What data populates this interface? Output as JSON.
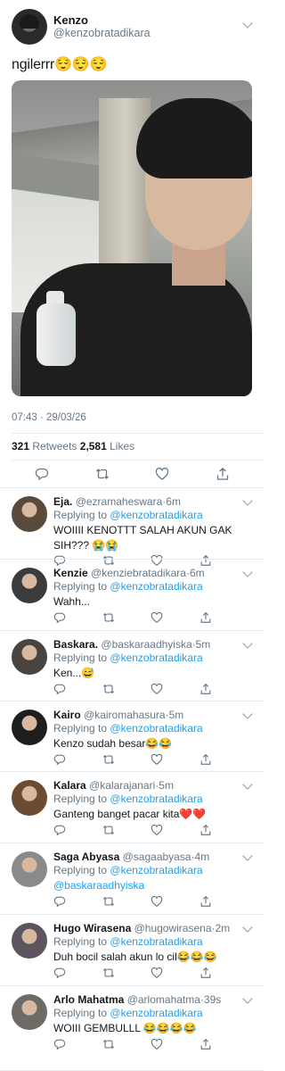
{
  "main_tweet": {
    "display_name": "Kenzo",
    "handle": "@kenzobratadikara",
    "text": "ngilerrr😌😌😌",
    "timestamp": "07:43 · 29/03/26",
    "retweets_count": "321",
    "retweets_label": "Retweets",
    "likes_count": "2,581",
    "likes_label": "Likes"
  },
  "action_icons": [
    "reply-icon",
    "retweet-icon",
    "like-icon",
    "share-icon"
  ],
  "replying_label": "Replying to",
  "replying_handle": "@kenzobratadikara",
  "replies": [
    {
      "name": "Eja.",
      "handle": "@ezramaheswara",
      "time": "6m",
      "text": "WOIIII KENOTTT SALAH AKUN GAK SIH??? 😭😭",
      "avatar_color": "#5a4a3c"
    },
    {
      "name": "Kenzie",
      "handle": "@kenziebratadikara",
      "time": "6m",
      "text": "Wahh...",
      "avatar_color": "#3b3b3b"
    },
    {
      "name": "Baskara.",
      "handle": "@baskaraadhyiska",
      "time": "5m",
      "text": "Ken...😅",
      "avatar_color": "#4a4440"
    },
    {
      "name": "Kairo",
      "handle": "@kairomahasura",
      "time": "5m",
      "text": "Kenzo sudah besar😂😂",
      "avatar_color": "#1e1e1e"
    },
    {
      "name": "Kalara",
      "handle": "@kalarajanari",
      "time": "5m",
      "text": "Ganteng banget pacar kita❤️❤️",
      "avatar_color": "#6b4c32"
    },
    {
      "name": "Saga Abyasa",
      "handle": "@sagaabyasa",
      "time": "4m",
      "text": "@baskaraadhyiska",
      "avatar_color": "#8a8a8a"
    },
    {
      "name": "Hugo Wirasena",
      "handle": "@hugowirasena",
      "time": "2m",
      "text": "Duh bocil salah akun lo cil😂😂😂",
      "avatar_color": "#5c5560"
    },
    {
      "name": "Arlo Mahatma",
      "handle": "@arlomahatma",
      "time": "39s",
      "text": "WOIII GEMBULLL 😂😂😂😂",
      "avatar_color": "#6e6a66"
    }
  ],
  "colors": {
    "accent": "#1da1f2",
    "muted": "#657786",
    "divider": "#e6ecf0",
    "text": "#14171a"
  }
}
